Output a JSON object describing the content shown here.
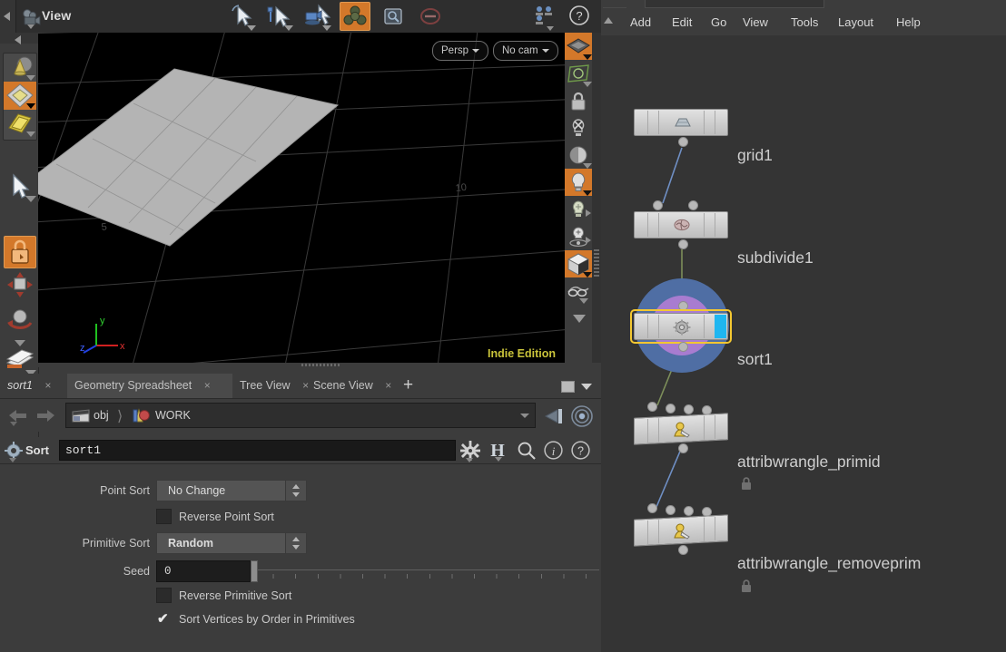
{
  "viewport_panel": {
    "toolbar": {
      "title": "View",
      "camera_icon": "camera-icon",
      "tools": [
        {
          "name": "select-tool",
          "icon": "arrow-cursor-icon",
          "active": false
        },
        {
          "name": "handle-tool",
          "icon": "arrow-handle-icon",
          "active": false
        },
        {
          "name": "view-tool",
          "icon": "camera-move-icon",
          "active": false
        },
        {
          "name": "object-mode",
          "icon": "object-cluster-icon",
          "active": true
        },
        {
          "name": "snapshot-tool",
          "icon": "snapshot-icon",
          "active": false
        },
        {
          "name": "disable-tool",
          "icon": "no-entry-icon",
          "active": false
        }
      ],
      "right_icons": [
        {
          "name": "viewport-layout-icon",
          "icon": "multi-pane-icon"
        },
        {
          "name": "help-icon",
          "icon": "question-circle-icon"
        }
      ]
    },
    "overlays": {
      "view_mode": "Persp",
      "camera": "No cam",
      "watermark": "Indie Edition",
      "axis_labels": {
        "x": "x",
        "y": "y",
        "z": "z"
      }
    },
    "left_rail": [
      {
        "name": "rail-item-model-ops",
        "icon": "cone-sphere-icon",
        "selected": false
      },
      {
        "name": "rail-item-polygon-ops",
        "icon": "diamond-icon",
        "selected": true
      },
      {
        "name": "rail-item-surface-ops",
        "icon": "plane-sheet-icon",
        "selected": false
      },
      {
        "name": "rail-item-select",
        "icon": "arrow-cursor-icon",
        "selected": false
      },
      {
        "name": "rail-item-handle-lock",
        "icon": "padlock-handle-icon",
        "selected": true
      },
      {
        "name": "rail-item-move",
        "icon": "move-arrows-icon",
        "selected": false
      },
      {
        "name": "rail-item-rotate",
        "icon": "rotate-sphere-icon",
        "selected": false
      },
      {
        "name": "rail-item-scale",
        "icon": "scale-stack-icon",
        "selected": false
      },
      {
        "name": "rail-item-film",
        "icon": "film-reel-icon",
        "selected": false
      }
    ],
    "right_rail": [
      {
        "name": "display-shaded-toggle",
        "icon": "shaded-plane-icon",
        "active": true
      },
      {
        "name": "display-wireframe-toggle",
        "icon": "wireframe-plane-icon",
        "active": false
      },
      {
        "name": "lock-camera-toggle",
        "icon": "padlock-icon",
        "active": false
      },
      {
        "name": "headlight-off-toggle",
        "icon": "bulb-crossed-icon",
        "active": false
      },
      {
        "name": "material-preview-toggle",
        "icon": "sphere-shading-icon",
        "active": false
      },
      {
        "name": "scene-lights-toggle",
        "icon": "bulb-icon",
        "active": true
      },
      {
        "name": "ambient-light-toggle",
        "icon": "bulb-outline-icon",
        "active": false
      },
      {
        "name": "light-placement-toggle",
        "icon": "bulb-target-icon",
        "active": false
      },
      {
        "name": "background-image-toggle",
        "icon": "cube-split-icon",
        "active": true
      },
      {
        "name": "ghost-display-toggle",
        "icon": "ghost-glasses-icon",
        "active": false
      },
      {
        "name": "rail-more-toggle",
        "icon": "chevron-down-icon",
        "active": false
      }
    ]
  },
  "tabs": {
    "items": [
      {
        "label": "sort1",
        "closable": true,
        "active": false,
        "current": true
      },
      {
        "label": "Geometry Spreadsheet",
        "closable": true,
        "active": true,
        "current": false
      },
      {
        "label": "Tree View",
        "closable": true,
        "active": false,
        "current": false
      },
      {
        "label": "Scene View",
        "closable": true,
        "active": false,
        "current": false
      }
    ],
    "close_glyph": "×",
    "add_label": "+",
    "maximize_icon": "maximize-icon",
    "menu_icon": "chevron-down-icon"
  },
  "pathbar": {
    "back_icon": "arrow-left-icon",
    "forward_icon": "arrow-right-icon",
    "crumbs": [
      {
        "label": "obj",
        "icon": "clapperboard-icon"
      },
      {
        "label": "WORK",
        "icon": "geometry-icon"
      }
    ],
    "dropdown_icon": "chevron-down-icon",
    "pin_icon": "pin-icon",
    "target_icon": "target-icon"
  },
  "parameters": {
    "header": {
      "node_type_icon": "gear-icon",
      "node_type_label": "Sort",
      "node_name": "sort1",
      "icons": [
        {
          "name": "gear-menu-icon",
          "glyph": "gear-icon"
        },
        {
          "name": "houdini-h-icon",
          "glyph": "h-logo-icon"
        },
        {
          "name": "search-icon",
          "glyph": "magnifier-icon"
        },
        {
          "name": "info-icon",
          "glyph": "info-circle-icon"
        },
        {
          "name": "help-icon",
          "glyph": "question-circle-icon"
        }
      ]
    },
    "rows": [
      {
        "type": "menu",
        "label": "Point Sort",
        "value": "No Change",
        "bold": false
      },
      {
        "type": "checkbox",
        "label": "Reverse Point Sort",
        "checked": false
      },
      {
        "type": "menu",
        "label": "Primitive Sort",
        "value": "Random",
        "bold": true
      },
      {
        "type": "slider",
        "label": "Seed",
        "value": "0"
      },
      {
        "type": "checkbox",
        "label": "Reverse Primitive Sort",
        "checked": false
      },
      {
        "type": "checkbox",
        "label": "Sort Vertices by Order in Primitives",
        "checked": true
      }
    ],
    "check_glyph": "✔"
  },
  "network_editor": {
    "menus": [
      "Add",
      "Edit",
      "Go",
      "View",
      "Tools",
      "Layout",
      "Help"
    ],
    "scroll_icon": "scroll-up-icon",
    "nodes": [
      {
        "name": "grid1",
        "icon": "grid-plane-icon",
        "selected": false,
        "locked": false,
        "inputs": 0,
        "outputs": 1,
        "display_flag": false
      },
      {
        "name": "subdivide1",
        "icon": "subdivide-icon",
        "selected": false,
        "locked": false,
        "inputs": 2,
        "outputs": 1,
        "display_flag": false
      },
      {
        "name": "sort1",
        "icon": "gear-icon",
        "selected": true,
        "locked": false,
        "inputs": 1,
        "outputs": 1,
        "display_flag": true
      },
      {
        "name": "attribwrangle_primid",
        "icon": "wrangle-vex-icon",
        "selected": false,
        "locked": true,
        "inputs": 4,
        "outputs": 1,
        "display_flag": false
      },
      {
        "name": "attribwrangle_removeprim",
        "icon": "wrangle-vex-icon",
        "selected": false,
        "locked": true,
        "inputs": 4,
        "outputs": 1,
        "display_flag": false
      }
    ],
    "lock_icon": "padlock-icon"
  },
  "colors": {
    "accent_orange": "#d3782a",
    "selection_yellow": "#f3c731",
    "display_flag_blue": "#1fb6f0",
    "halo_outer_blue": "#4f6ea4",
    "halo_inner_purple": "#a87cd0",
    "watermark_yellow": "#c9c33a",
    "panel_bg": "#3c3c3c",
    "network_bg": "#343434",
    "wire_blue": "#6f8fc4",
    "wire_green": "#7d8f5a"
  }
}
